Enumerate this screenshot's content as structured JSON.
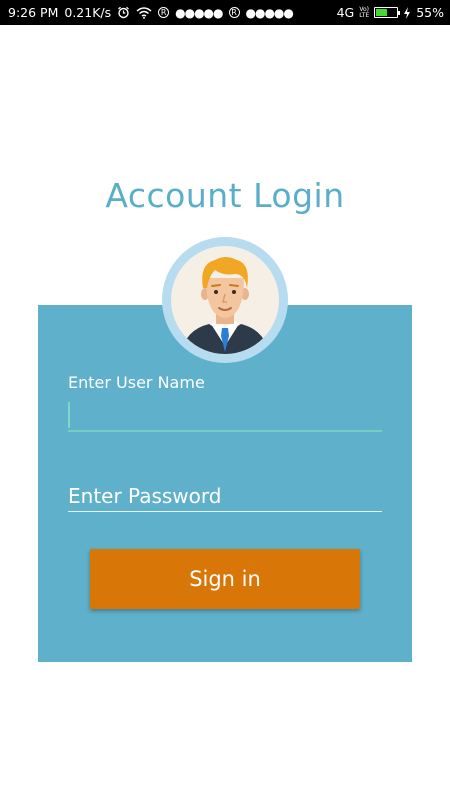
{
  "status_bar": {
    "time": "9:26 PM",
    "speed": "0.21K/s",
    "alarm_icon": "alarm-clock-icon",
    "wifi_icon": "wifi-icon",
    "registered_mark": "R",
    "signal_dots_1": "●●●●●",
    "signal_dots_2": "●●●●●",
    "network": "4G",
    "volte_top": "Vo)",
    "volte_bottom": "LTE",
    "battery_percent": "55%",
    "battery_level": 0.55,
    "battery_color": "#3ddc2e"
  },
  "page": {
    "title": "Account Login",
    "accent_color": "#5fb0cb",
    "title_color": "#5aafc8",
    "avatar_icon": "user-avatar-icon"
  },
  "form": {
    "username_label": "Enter User Name",
    "username_value": "",
    "password_placeholder": "Enter Password",
    "password_value": "",
    "signin_label": "Sign in",
    "button_color": "#d97608"
  }
}
